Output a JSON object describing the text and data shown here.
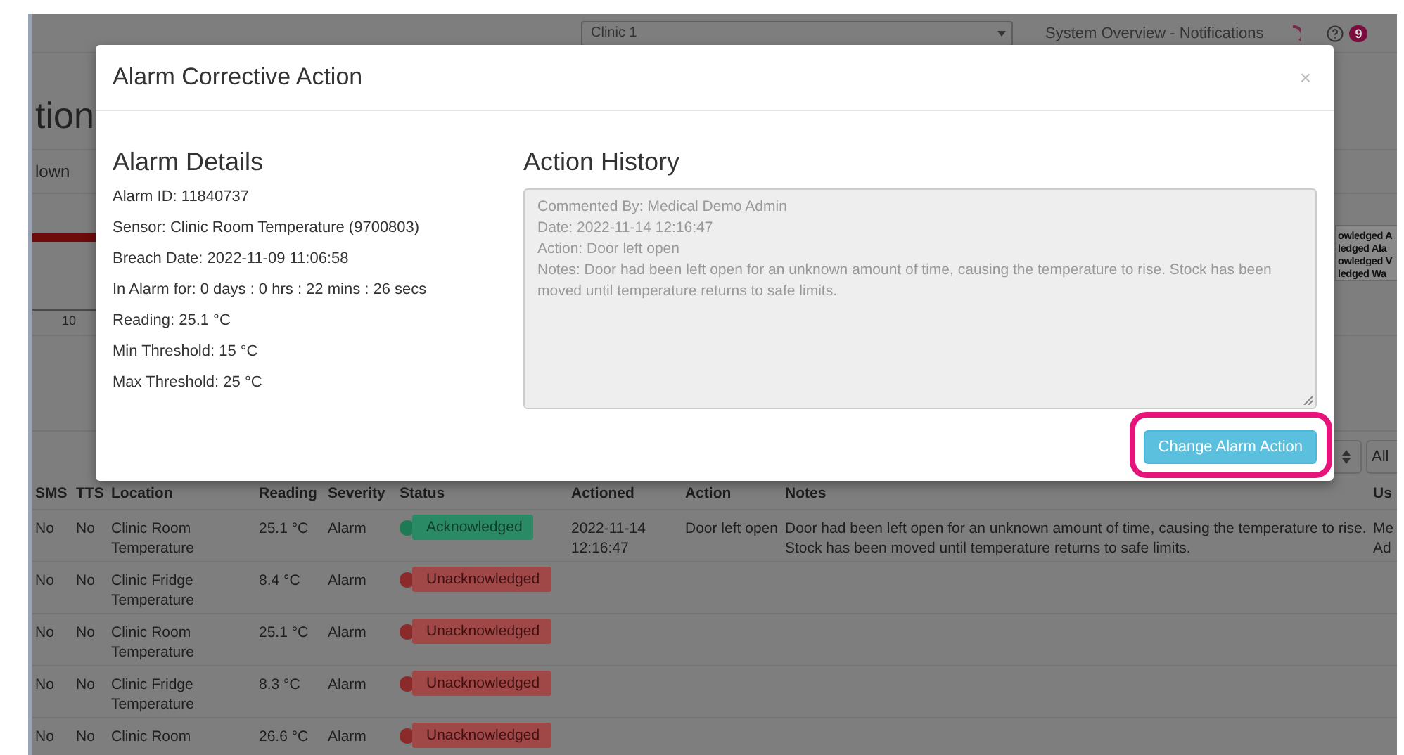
{
  "top_bar": {
    "clinic_select": "Clinic 1",
    "page_title": "System Overview - Notifications",
    "badge": "9"
  },
  "page_heading": "tion",
  "tab_fragment": "lown",
  "chart_fragment": {
    "tick": "10"
  },
  "legend_fragments": [
    "owledged A",
    "ledged Ala",
    "owledged V",
    "ledged Wa"
  ],
  "filter_fragment": "All",
  "table": {
    "columns": [
      "SMS",
      "TTS",
      "Location",
      "Reading",
      "Severity",
      "Status",
      "Actioned",
      "Action",
      "Notes",
      "Us"
    ],
    "rows": [
      {
        "sms": "No",
        "tts": "No",
        "location": "Clinic Room Temperature",
        "reading": "25.1 °C",
        "severity": "Alarm",
        "status": "Acknowledged",
        "kind": "acknowledged",
        "color": "#1e7a55",
        "actioned": "2022-11-14 12:16:47",
        "action": "Door left open",
        "notes": "Door had been left open for an unknown amount of time, causing the temperature to rise. Stock has been moved until temperature returns to safe limits.",
        "user": "Me Ad"
      },
      {
        "sms": "No",
        "tts": "No",
        "location": "Clinic Fridge Temperature",
        "reading": "8.4 °C",
        "severity": "Alarm",
        "status": "Unacknowledged",
        "kind": "unacknowledged",
        "color": "#8a2a2a"
      },
      {
        "sms": "No",
        "tts": "No",
        "location": "Clinic Room Temperature",
        "reading": "25.1 °C",
        "severity": "Alarm",
        "status": "Unacknowledged",
        "kind": "unacknowledged",
        "color": "#8a2a2a"
      },
      {
        "sms": "No",
        "tts": "No",
        "location": "Clinic Fridge Temperature",
        "reading": "8.3 °C",
        "severity": "Alarm",
        "status": "Unacknowledged",
        "kind": "unacknowledged",
        "color": "#8a2a2a"
      },
      {
        "sms": "No",
        "tts": "No",
        "location": "Clinic Room",
        "reading": "26.6 °C",
        "severity": "Alarm",
        "status": "Unacknowledged",
        "kind": "unacknowledged",
        "color": "#8a2a2a"
      }
    ]
  },
  "modal": {
    "title": "Alarm Corrective Action",
    "close": "×",
    "details_heading": "Alarm Details",
    "details": [
      "Alarm ID: 11840737",
      "Sensor: Clinic Room Temperature (9700803)",
      "Breach Date: 2022-11-09 11:06:58",
      "In Alarm for: 0 days : 0 hrs : 22 mins : 26 secs",
      "Reading: 25.1 °C",
      "Min Threshold: 15 °C",
      "Max Threshold: 25 °C"
    ],
    "history_heading": "Action History",
    "history_lines": [
      "Commented By: Medical Demo Admin",
      "Date: 2022-11-14 12:16:47",
      "Action: Door left open",
      "Notes: Door had been left open for an unknown amount of time, causing the temperature to rise. Stock has been moved until temperature returns to safe limits."
    ],
    "button": "Change Alarm Action"
  }
}
